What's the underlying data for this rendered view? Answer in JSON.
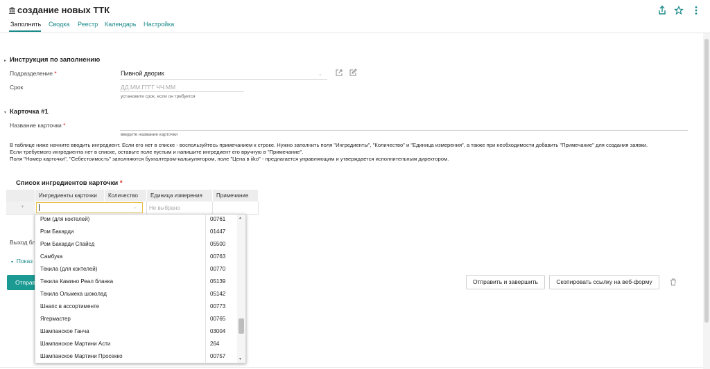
{
  "header": {
    "title": "создание новых ТТК",
    "tabs": [
      {
        "label": "Заполнить"
      },
      {
        "label": "Сводка"
      },
      {
        "label": "Реестр"
      },
      {
        "label": "Календарь"
      },
      {
        "label": "Настройка"
      }
    ],
    "active_tab": "Заполнить",
    "icons": [
      "share-icon",
      "star-icon",
      "more-vertical-icon"
    ]
  },
  "instructions_section": {
    "title": "Инструкция по заполнению",
    "department_label": "Подразделение",
    "department_value": "Пивной дворик",
    "deadline_label": "Срок",
    "deadline_placeholder": "ДД.ММ.ГГГГ ЧЧ:ММ",
    "deadline_hint": "установите срок, если он требуется"
  },
  "card_section": {
    "title": "Карточка #1",
    "card_name_label": "Название карточки",
    "card_name_hint": "введите название карточки",
    "instructions_line1": "В таблице ниже начните вводить ингредиент. Если его нет в списке - воспользуйтесь примечанием к строке. Нужно заполнить поля \"Ингредиенты\", \"Количество\" и \"Единица измерения\", а также при необходимости добавить \"Примечание\" для создания заявки.",
    "instructions_line2": "Если требуемого ингредиента нет в списке, оставьте поле пустым и  напишите ингредиент его вручную в \"Примечание\".",
    "instructions_line3": "Поля \"Номер карточки\", \"Себестоимость\" заполняются бухгалтером-калькулятором, поле \"Цена в iiko\" - предлагается управляющим и утверждается исполнительным директором.",
    "ingredients_table_title": "Список ингредиентов карточки",
    "columns": [
      "Ингредиенты карточки",
      "Количество",
      "Единица измерения",
      "Примечание"
    ],
    "unit_placeholder": "Не выбрано",
    "output_label_partial": "Выход бл",
    "show_label_partial": "Показ",
    "send_button_partial": "Отправ"
  },
  "dropdown": {
    "items": [
      {
        "name": "Ром (для коктелей)",
        "code": "00761"
      },
      {
        "name": "Ром Бакарди",
        "code": "01447"
      },
      {
        "name": "Ром Бакарди Спайсд",
        "code": "05500"
      },
      {
        "name": "Самбука",
        "code": "00763"
      },
      {
        "name": "Текила (для коктелей)",
        "code": "00770"
      },
      {
        "name": "Текила Камино Реал бланка",
        "code": "05139"
      },
      {
        "name": "Текила Ольмека шоколад",
        "code": "05142"
      },
      {
        "name": "Шнапс в ассортименте",
        "code": "00773"
      },
      {
        "name": "Ягермастер",
        "code": "00765"
      },
      {
        "name": "Шампанское Ганча",
        "code": "03004"
      },
      {
        "name": "Шампанское Мартини Асти",
        "code": "264"
      },
      {
        "name": "Шампанское Мартини Просекко",
        "code": "00757"
      }
    ]
  },
  "actions": {
    "send_and_finish": "Отправить и завершить",
    "copy_link": "Скопировать ссылку на веб-форму"
  },
  "colors": {
    "accent": "#1a8a8a",
    "primary_button": "#1a9a92",
    "required": "#d22222"
  }
}
